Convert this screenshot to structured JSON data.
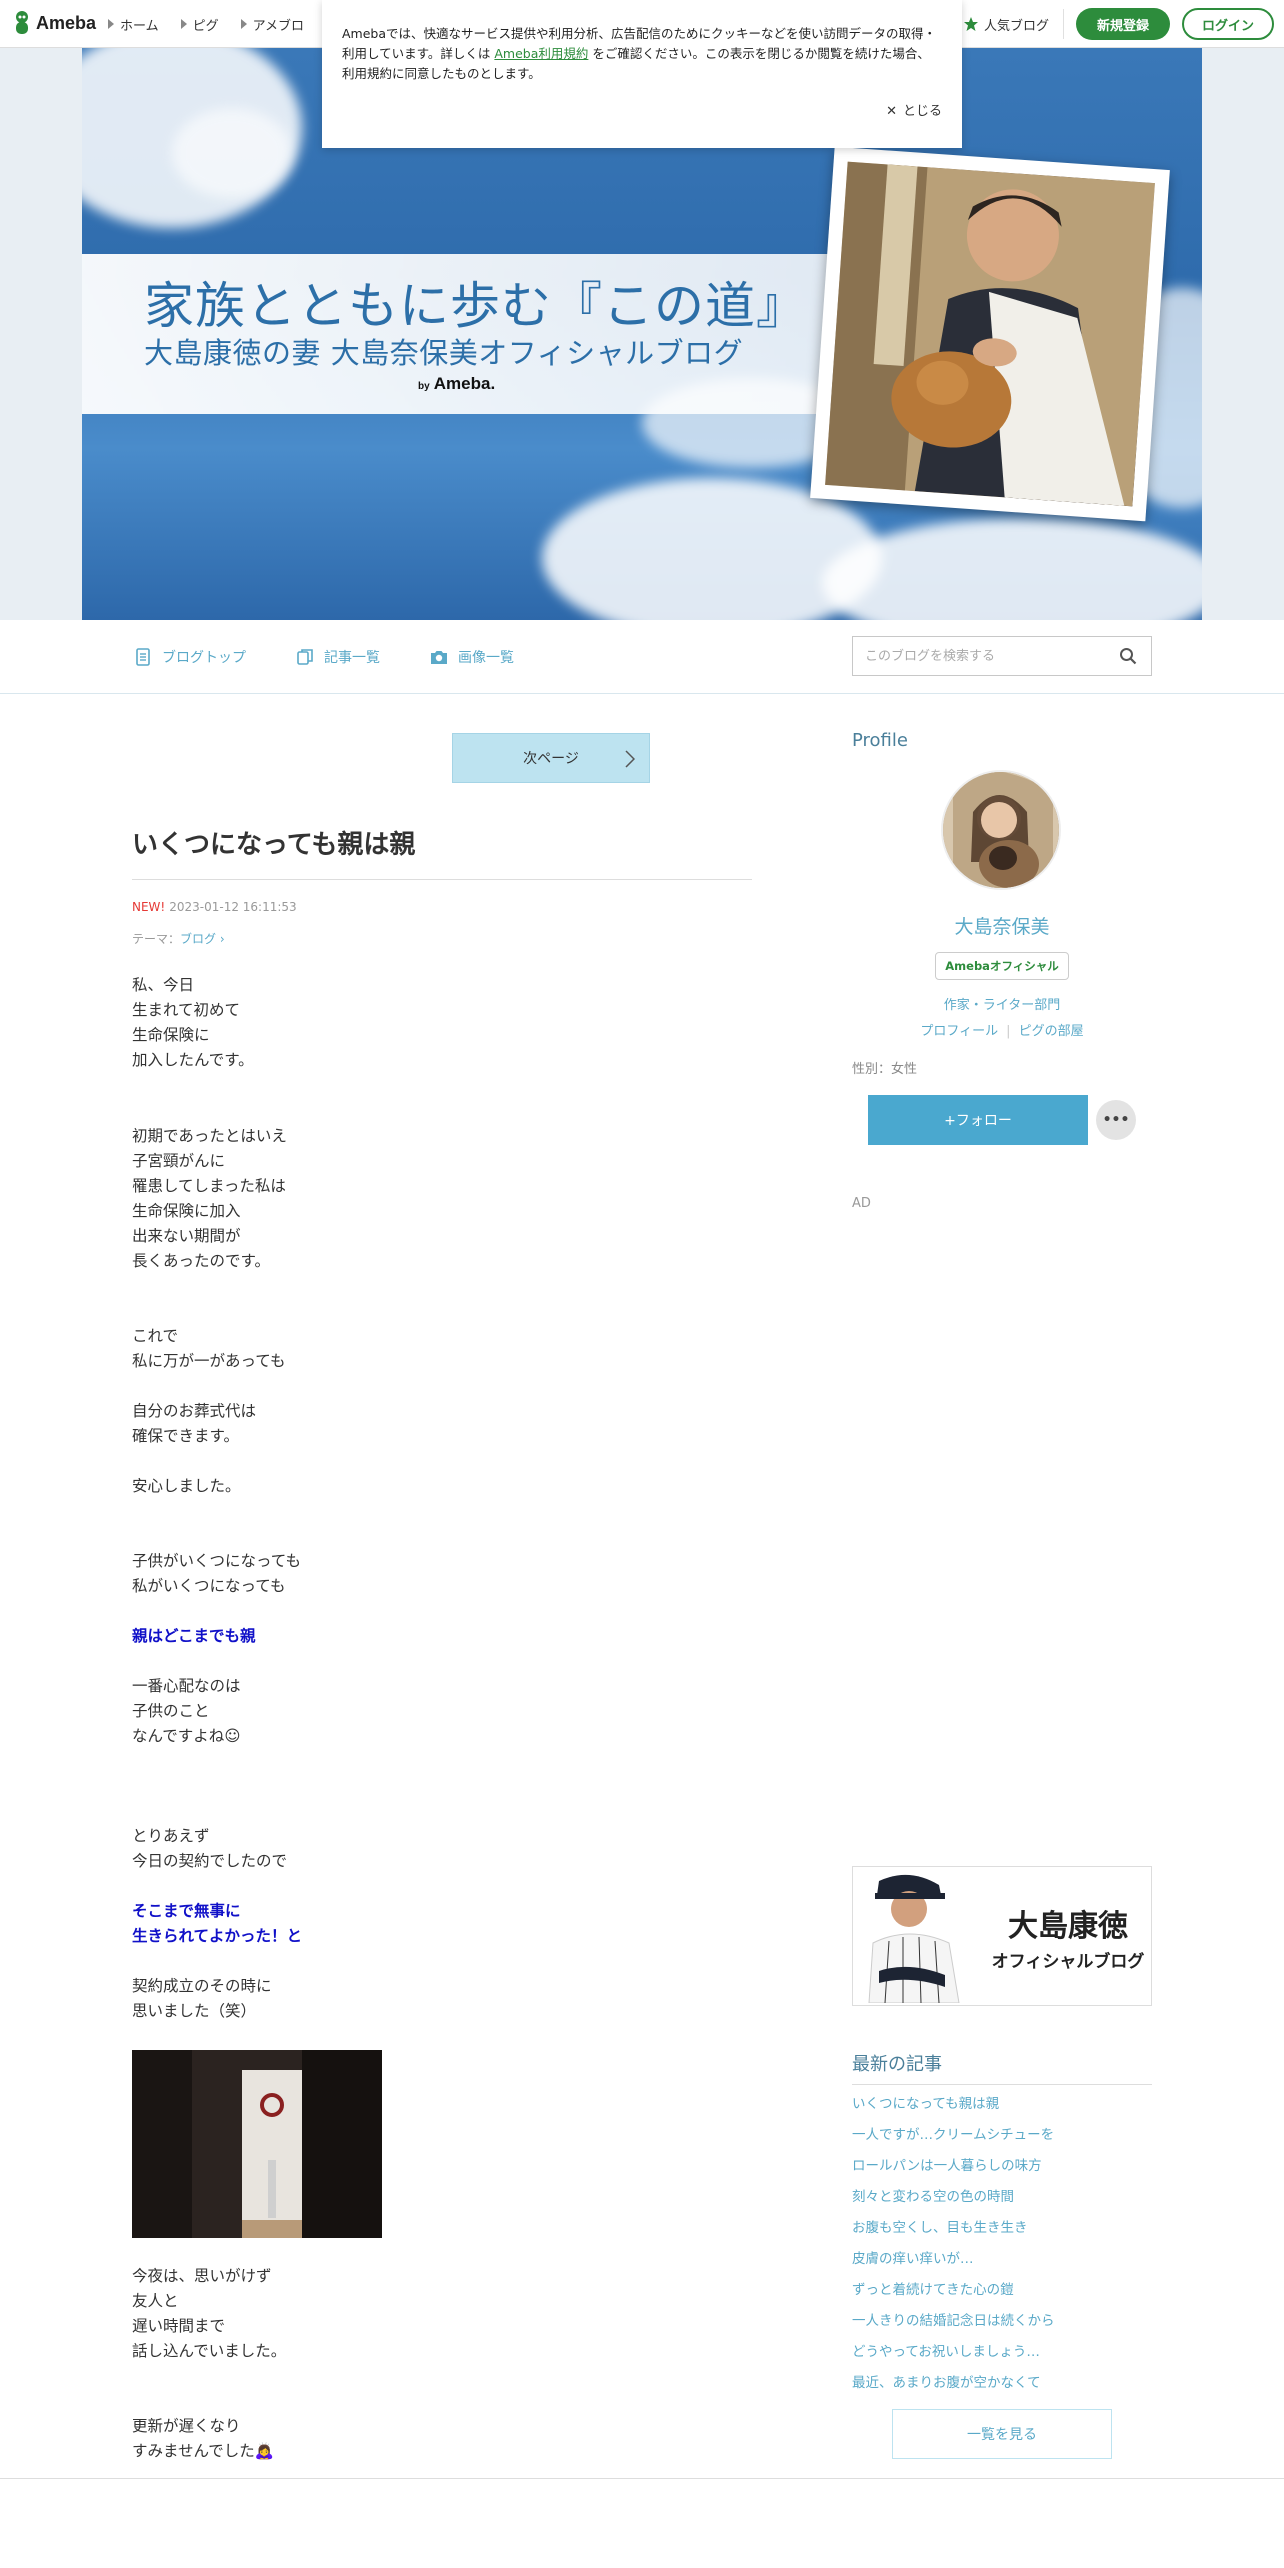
{
  "topbar": {
    "logo_text": "Ameba",
    "nav": [
      {
        "label": "ホーム"
      },
      {
        "label": "ピグ"
      },
      {
        "label": "アメブロ"
      }
    ],
    "popular_label": "人気ブログ",
    "signup_label": "新規登録",
    "login_label": "ログイン",
    "accent_color": "#2d8c3c"
  },
  "cookie": {
    "text_before": "Amebaでは、快適なサービス提供や利用分析、広告配信のためにクッキーなどを使い訪問データの取得・利用しています。詳しくは",
    "link_text": "Ameba利用規約",
    "text_after": "をご確認ください。この表示を閉じるか閲覧を続けた場合、利用規約に同意したものとします。",
    "close_label": "とじる"
  },
  "banner": {
    "title": "家族とともに歩む『この道』",
    "subtitle": "大島康徳の妻 大島奈保美オフィシャルブログ",
    "by_text": "by",
    "by_brand": "Ameba."
  },
  "blognav": {
    "items": [
      {
        "label": "ブログトップ",
        "icon": "document-icon"
      },
      {
        "label": "記事一覧",
        "icon": "copy-icon"
      },
      {
        "label": "画像一覧",
        "icon": "camera-icon"
      }
    ],
    "search_placeholder": "このブログを検索する"
  },
  "article": {
    "next_page_label": "次ページ",
    "title": "いくつになっても親は親",
    "new_badge": "NEW!",
    "date": "2023-01-12 16:11:53",
    "theme_prefix": "テーマ：",
    "theme": "ブログ",
    "paragraphs": [
      "私、今日\n生まれて初めて\n生命保険に\n加入したんです。",
      "初期であったとはいえ\n子宮頸がんに\n罹患してしまった私は\n生命保険に加入\n出来ない期間が\n長くあったのです。",
      "これで\n私に万が一があっても",
      "自分のお葬式代は\n確保できます。",
      "安心しました。",
      "子供がいくつになっても\n私がいくつになっても",
      "親はどこまでも親",
      "一番心配なのは\n子供のこと\nなんですよね☺",
      "とりあえず\n今日の契約でしたので",
      "そこまで無事に\n生きられてよかった！と",
      "契約成立のその時に\n思いました（笑）",
      "今夜は、思いがけず\n友人と\n遅い時間まで\n話し込んでいました。",
      "更新が遅くなり\nすみませんでした🙇‍♀️"
    ]
  },
  "sidebar": {
    "profile_heading": "Profile",
    "name": "大島奈保美",
    "badge": "Amebaオフィシャル",
    "category": "作家・ライター部門",
    "link_profile": "プロフィール",
    "link_pig": "ピグの部屋",
    "gender": "性別：女性",
    "follow_label": "+フォロー",
    "more_label": "•••",
    "ad_label": "AD",
    "husband_banner": {
      "name": "大島康徳",
      "sub": "オフィシャルブログ"
    },
    "latest_heading": "最新の記事",
    "latest": [
      "いくつになっても親は親",
      "一人ですが…クリームシチューを",
      "ロールパンは一人暮らしの味方",
      "刻々と変わる空の色の時間",
      "お腹も空くし、目も生き生き",
      "皮膚の痒い痒いが…",
      "ずっと着続けてきた心の鎧",
      "一人きりの結婚記念日は続くから",
      "どうやってお祝いしましょう…",
      "最近、あまりお腹が空かなくて"
    ],
    "see_all_label": "一覧を見る"
  }
}
